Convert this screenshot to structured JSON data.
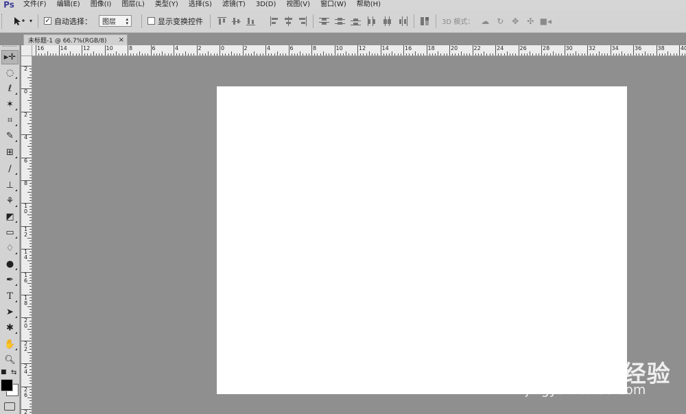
{
  "app": {
    "logo": "Ps"
  },
  "menu": [
    "文件(F)",
    "编辑(E)",
    "图像(I)",
    "图层(L)",
    "类型(Y)",
    "选择(S)",
    "滤镜(T)",
    "3D(D)",
    "视图(V)",
    "窗口(W)",
    "帮助(H)"
  ],
  "options": {
    "auto_select_label": "自动选择：",
    "auto_select_checked": true,
    "auto_select_value": "图层",
    "show_transform_label": "显示变换控件",
    "show_transform_checked": false,
    "mode3d_label": "3D 模式："
  },
  "document_tab": {
    "title": "未标题-1 @ 66.7%(RGB/8)",
    "close": "×"
  },
  "ruler_top_labels": [
    "16",
    "14",
    "12",
    "10",
    "8",
    "6",
    "4",
    "2",
    "0",
    "2",
    "4",
    "6",
    "8",
    "10",
    "12",
    "14",
    "16",
    "18",
    "20",
    "22",
    "24",
    "26",
    "28",
    "30",
    "32",
    "34",
    "36",
    "38",
    "40"
  ],
  "ruler_left_labels": [
    "2",
    "0",
    "2",
    "4",
    "6",
    "8",
    "10",
    "12",
    "14",
    "16",
    "18",
    "20",
    "22",
    "24",
    "26",
    "2"
  ],
  "watermark": {
    "logo": "Bai du 经验",
    "url": "jingyan.baidu.com"
  },
  "colors": {
    "foreground": "#000000",
    "background": "#ffffff",
    "workspace": "#8f8f8f",
    "canvas": "#ffffff"
  }
}
